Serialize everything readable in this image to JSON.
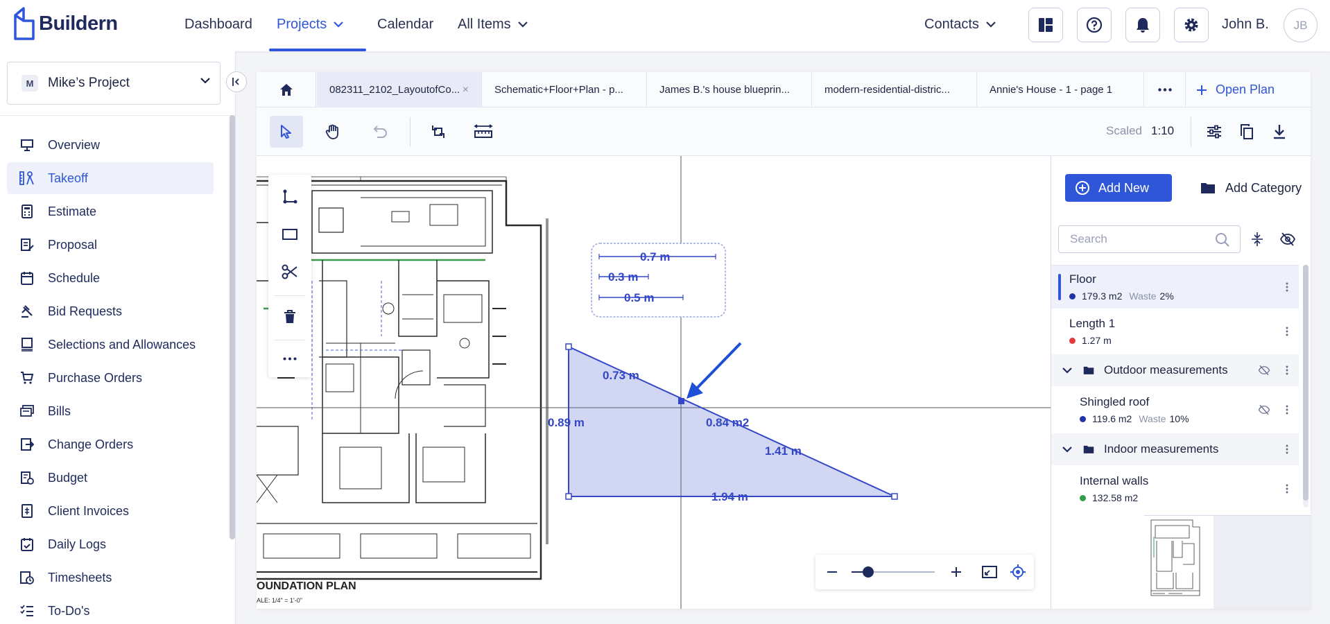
{
  "app": {
    "name": "Buildern"
  },
  "nav": {
    "dashboard": "Dashboard",
    "projects": "Projects",
    "calendar": "Calendar",
    "all_items": "All Items",
    "contacts": "Contacts"
  },
  "user": {
    "name": "John B.",
    "initials": "JB"
  },
  "project": {
    "badge": "M",
    "name": "Mike’s Project"
  },
  "sidebar": {
    "items": [
      {
        "label": "Overview"
      },
      {
        "label": "Takeoff"
      },
      {
        "label": "Estimate"
      },
      {
        "label": "Proposal"
      },
      {
        "label": "Schedule"
      },
      {
        "label": "Bid Requests"
      },
      {
        "label": "Selections and Allowances"
      },
      {
        "label": "Purchase Orders"
      },
      {
        "label": "Bills"
      },
      {
        "label": "Change Orders"
      },
      {
        "label": "Budget"
      },
      {
        "label": "Client Invoices"
      },
      {
        "label": "Daily Logs"
      },
      {
        "label": "Timesheets"
      },
      {
        "label": "To-Do's"
      }
    ],
    "active": "Takeoff"
  },
  "tabs": [
    {
      "label": "082311_2102_LayoutofCo..."
    },
    {
      "label": "Schematic+Floor+Plan - p..."
    },
    {
      "label": "James B.'s house blueprin..."
    },
    {
      "label": "modern-residential-distric..."
    },
    {
      "label": "Annie's House - 1 - page 1"
    }
  ],
  "open_plan": "Open Plan",
  "toolbar": {
    "scaled_label": "Scaled",
    "scaled_value": "1:10"
  },
  "drawing": {
    "legend_labels": [
      "0.7 m",
      "0.3 m",
      "0.5 m"
    ],
    "triangle_labels": {
      "top_edge": "0.73 m",
      "left_edge": "0.89 m",
      "area": "0.84 m2",
      "hypotenuse": "1.41 m",
      "bottom_edge": "1.94 m"
    },
    "plan_title": "OUNDATION PLAN",
    "plan_scale": "ALE: 1/4\" = 1'-0\""
  },
  "zoom": {
    "level": 0.2
  },
  "rpanel": {
    "add_new": "Add New",
    "add_category": "Add Category",
    "search_placeholder": "Search",
    "floor": {
      "name": "Floor",
      "value": "179.3 m2",
      "waste_label": "Waste",
      "waste_value": "2%",
      "color": "#2233a8"
    },
    "length": {
      "name": "Length 1",
      "value": "1.27 m",
      "color": "#e03a3a"
    },
    "outdoor_category": "Outdoor measurements",
    "roof": {
      "name": "Shingled roof",
      "value": "119.6 m2",
      "waste_label": "Waste",
      "waste_value": "10%",
      "color": "#2233a8"
    },
    "indoor_category": "Indoor measurements",
    "walls": {
      "name": "Internal walls",
      "value": "132.58 m2",
      "color": "#2e9e4a"
    }
  },
  "colors": {
    "accent": "#2f56d8",
    "navy": "#1f2a5c",
    "measure": "#3446c8"
  }
}
